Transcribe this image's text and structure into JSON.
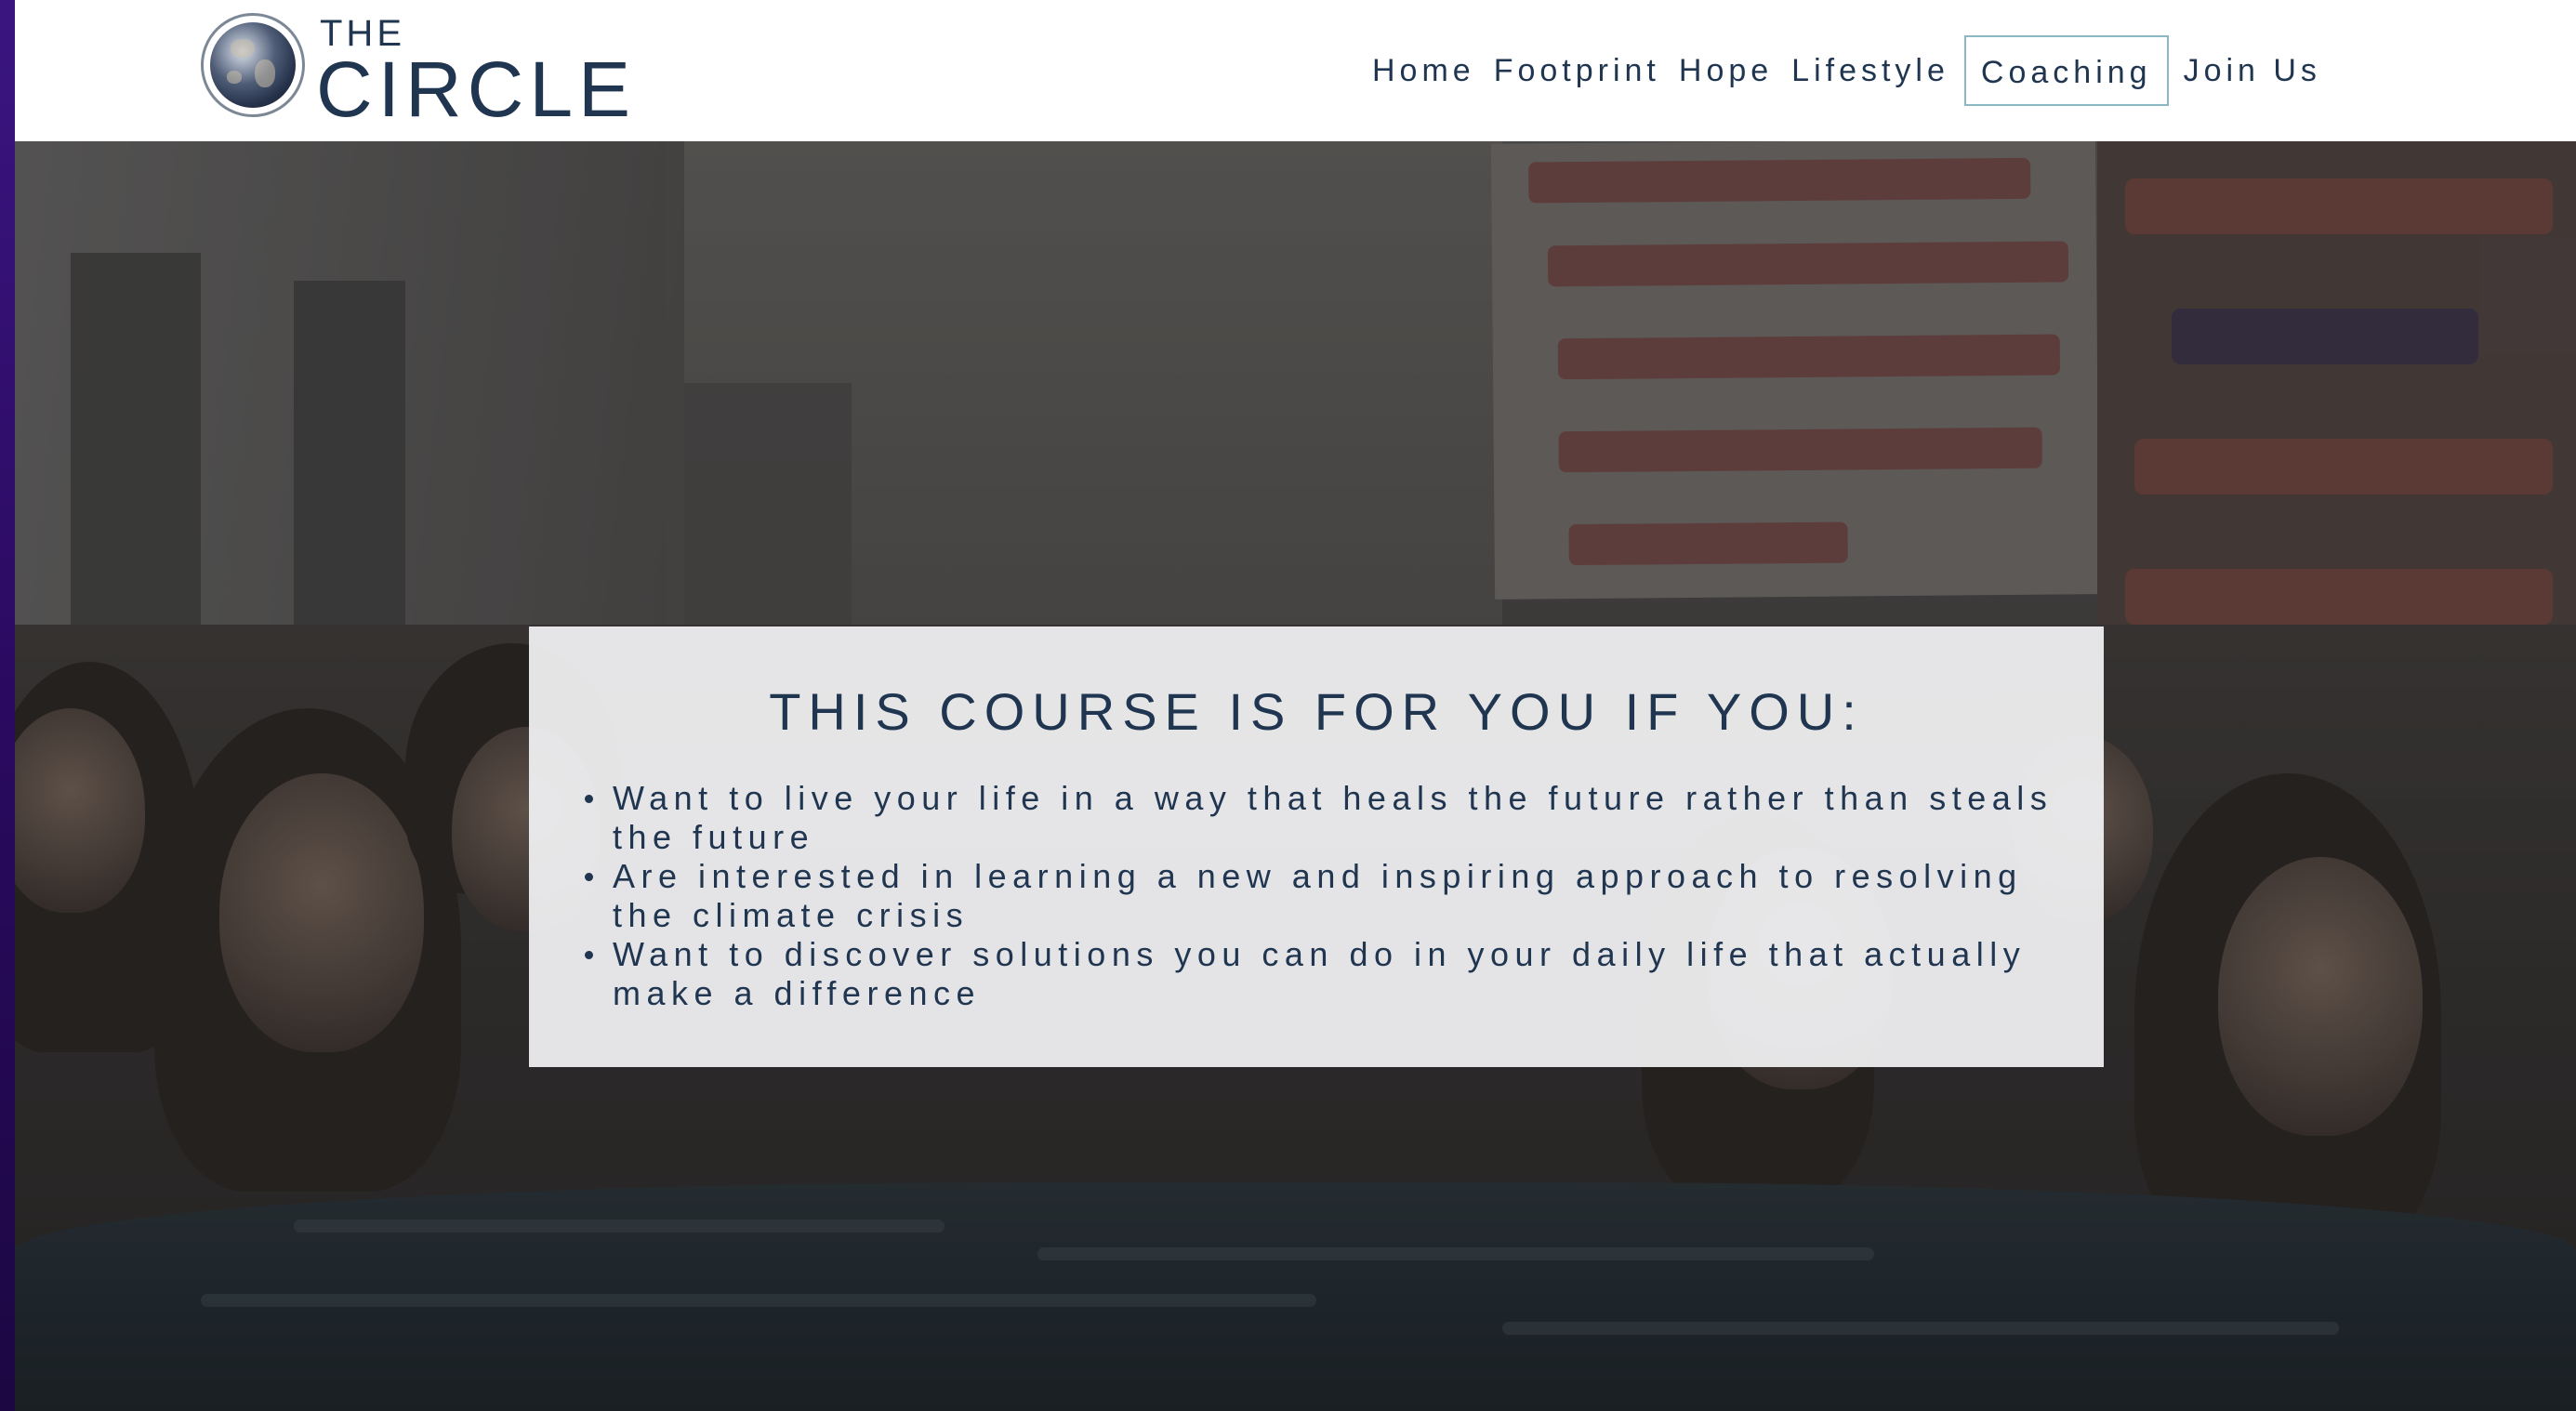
{
  "brand": {
    "the": "THE",
    "circle": "CIRCLE"
  },
  "nav": {
    "items": [
      {
        "label": "Home"
      },
      {
        "label": "Footprint"
      },
      {
        "label": "Hope"
      },
      {
        "label": "Lifestyle"
      },
      {
        "label": "Coaching",
        "active": true
      },
      {
        "label": "Join Us"
      }
    ]
  },
  "hero": {
    "panel_title": "THIS COURSE IS FOR YOU IF YOU:",
    "bullets": [
      "Want to live your life in a way that heals the future rather than steals the future",
      "Are interested in learning a new and inspiring approach to resolving the climate crisis",
      "Want to discover solutions you can do in your daily life that actually make a difference"
    ]
  },
  "colors": {
    "brand_text": "#1f3550",
    "active_nav_border": "#8ab9c4",
    "panel_background": "#f0f0f2",
    "page_edge": "#2a0d5c"
  },
  "icons": {
    "logo": "globe-icon",
    "bullet": "bullet-dot-icon"
  }
}
